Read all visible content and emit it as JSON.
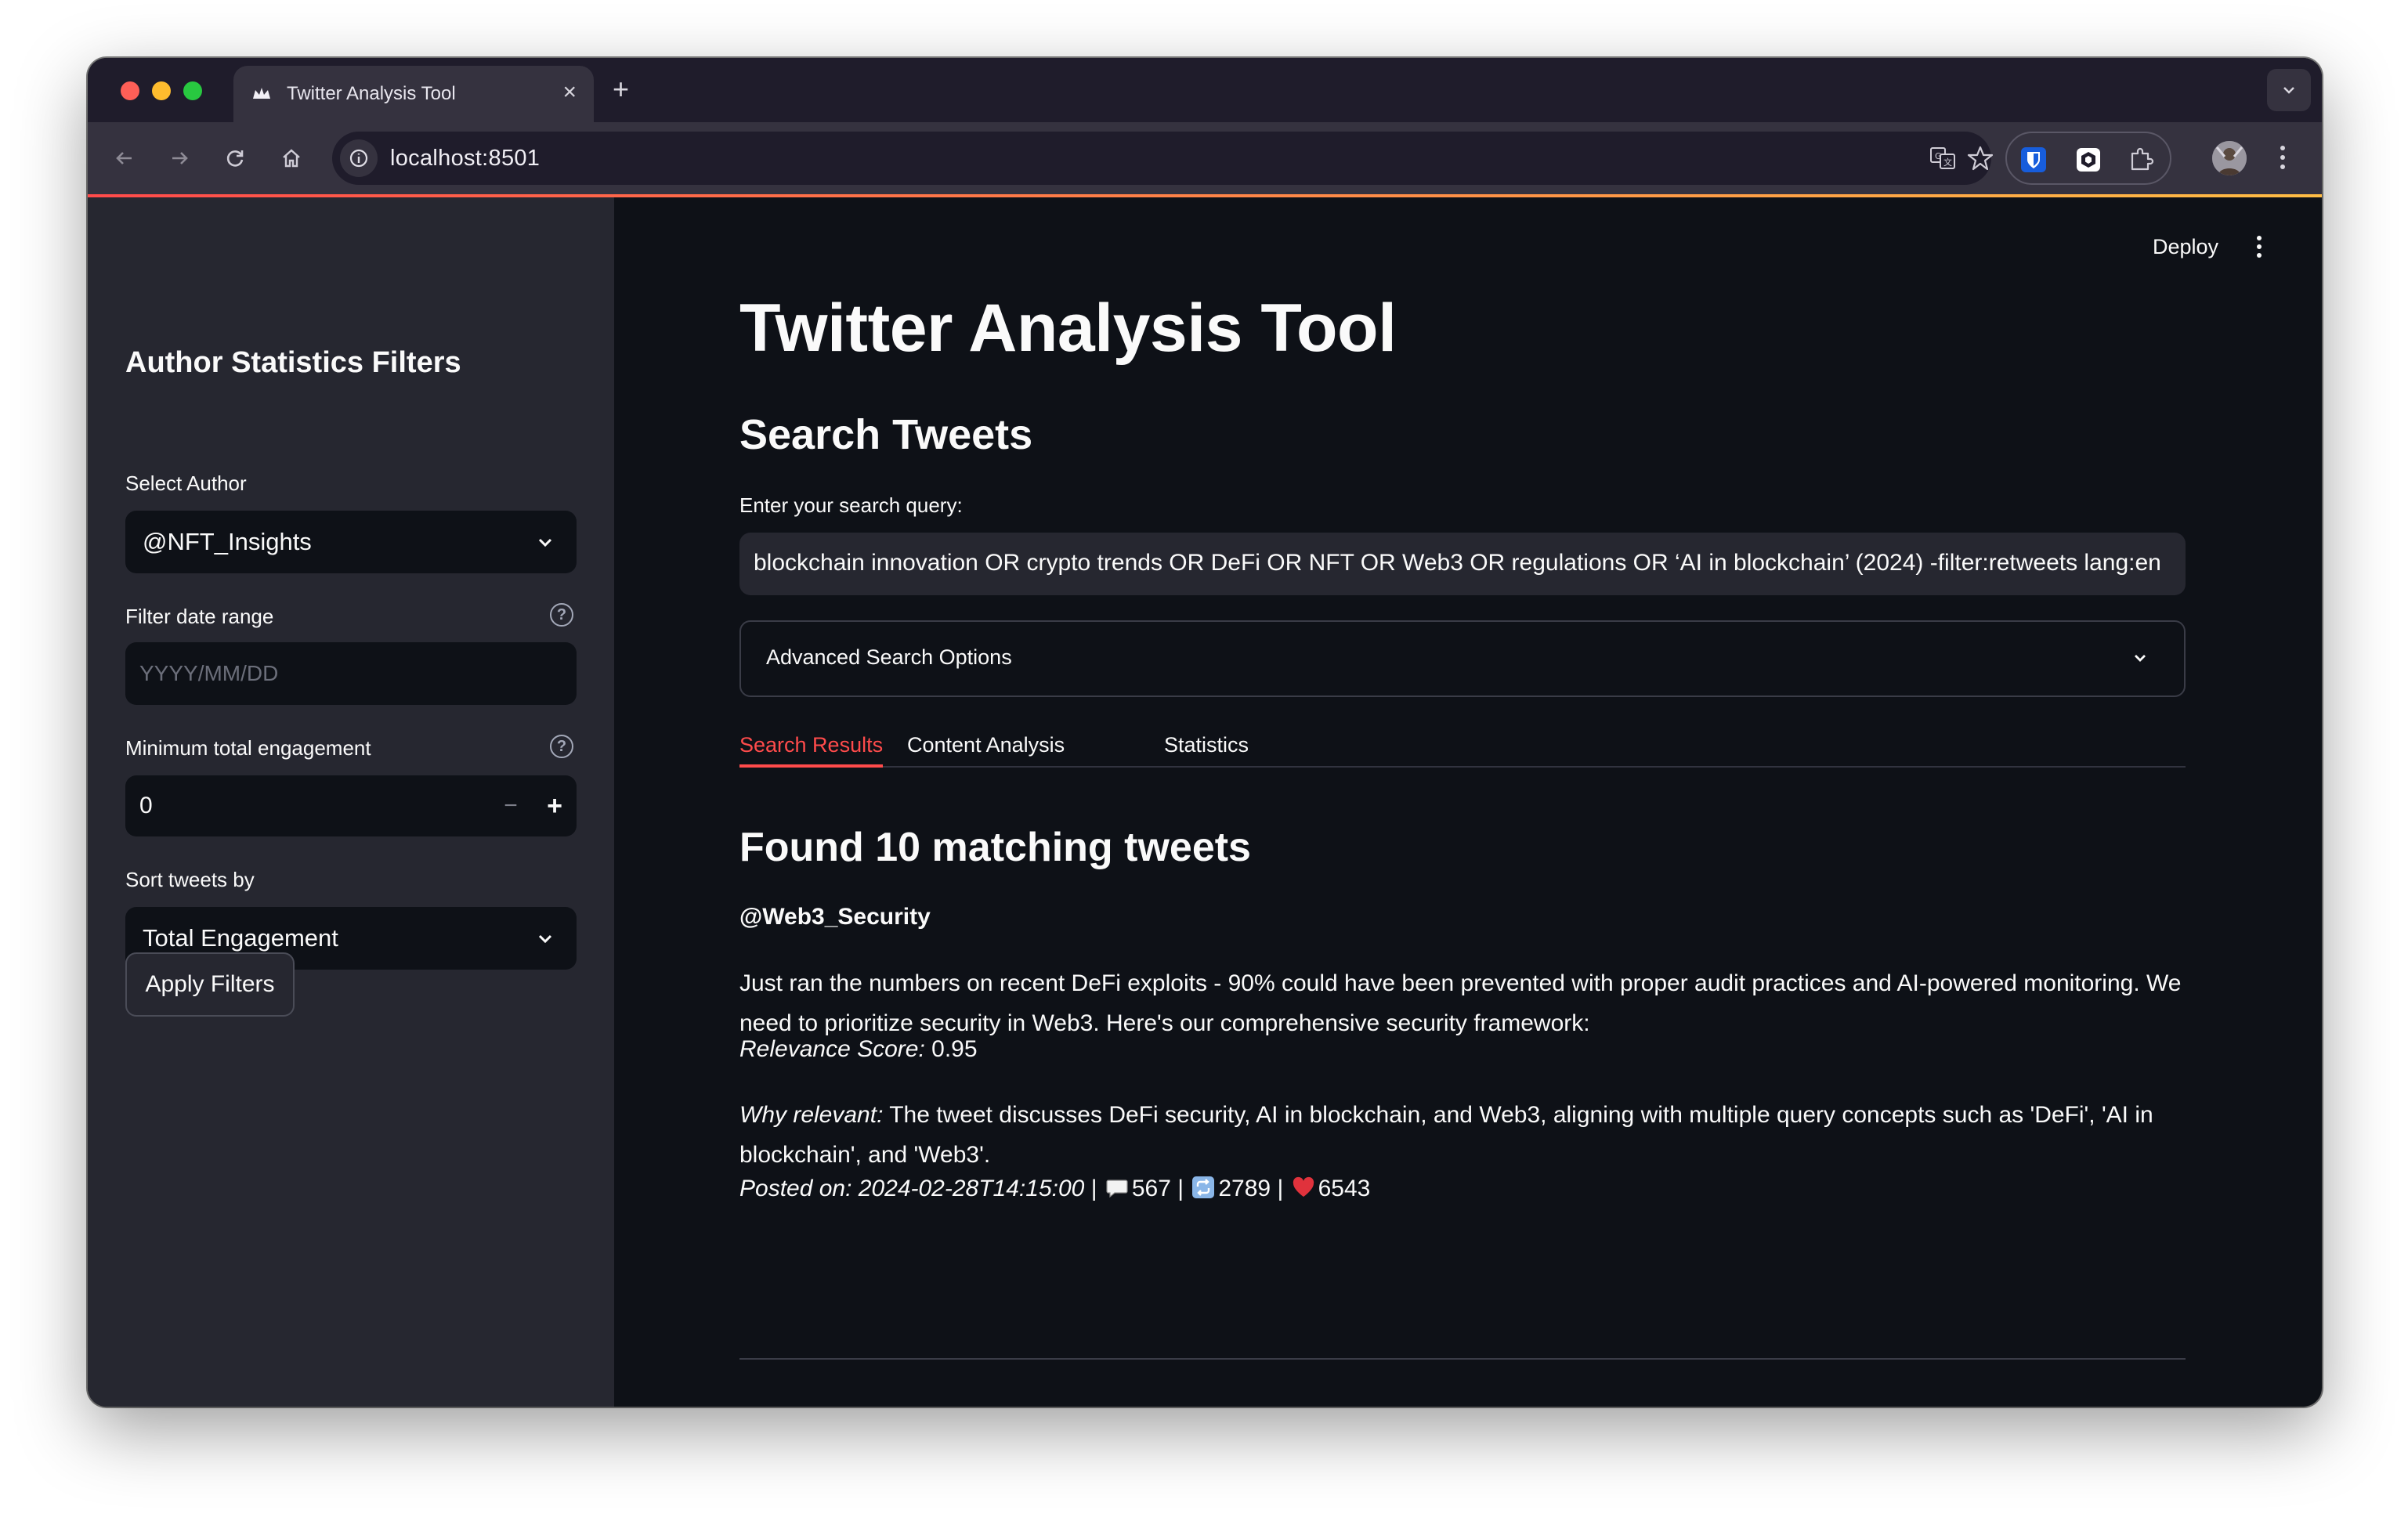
{
  "browser": {
    "tab_title": "Twitter Analysis Tool",
    "url": "localhost:8501"
  },
  "sidebar": {
    "title": "Author Statistics Filters",
    "author_label": "Select Author",
    "author_value": "@NFT_Insights",
    "date_label": "Filter date range",
    "date_placeholder": "YYYY/MM/DD",
    "engagement_label": "Minimum total engagement",
    "engagement_value": "0",
    "sort_label": "Sort tweets by",
    "sort_value": "Total Engagement",
    "apply_label": "Apply Filters"
  },
  "header": {
    "deploy_label": "Deploy"
  },
  "main": {
    "title": "Twitter Analysis Tool",
    "search_heading": "Search Tweets",
    "query_label": "Enter your search query:",
    "query_value": "blockchain innovation OR crypto trends OR DeFi OR NFT OR Web3 OR regulations OR ‘AI in blockchain’ (2024) -filter:retweets lang:en",
    "advanced_label": "Advanced Search Options",
    "tabs": [
      {
        "label": "Search Results",
        "active": true
      },
      {
        "label": "Content Analysis",
        "active": false
      },
      {
        "label": "Statistics",
        "active": false
      }
    ],
    "results_heading": "Found 10 matching tweets",
    "tweet": {
      "author": "@Web3_Security",
      "text": "Just ran the numbers on recent DeFi exploits - 90% could have been prevented with proper audit practices and AI-powered monitoring. We need to prioritize security in Web3. Here's our comprehensive security framework:",
      "relevance_label": "Relevance Score:",
      "relevance_value": "0.95",
      "why_label": "Why relevant:",
      "why_text": "The tweet discusses DeFi security, AI in blockchain, and Web3, aligning with multiple query concepts such as 'DeFi', 'AI in blockchain', and 'Web3'.",
      "posted_label": "Posted on: 2024-02-28T14:15:00",
      "separator": "|",
      "replies": "567",
      "retweets": "2789",
      "likes": "6543"
    }
  },
  "colors": {
    "accent": "#ff4b4b",
    "main_bg": "#0e1117",
    "sidebar_bg": "#262730"
  }
}
